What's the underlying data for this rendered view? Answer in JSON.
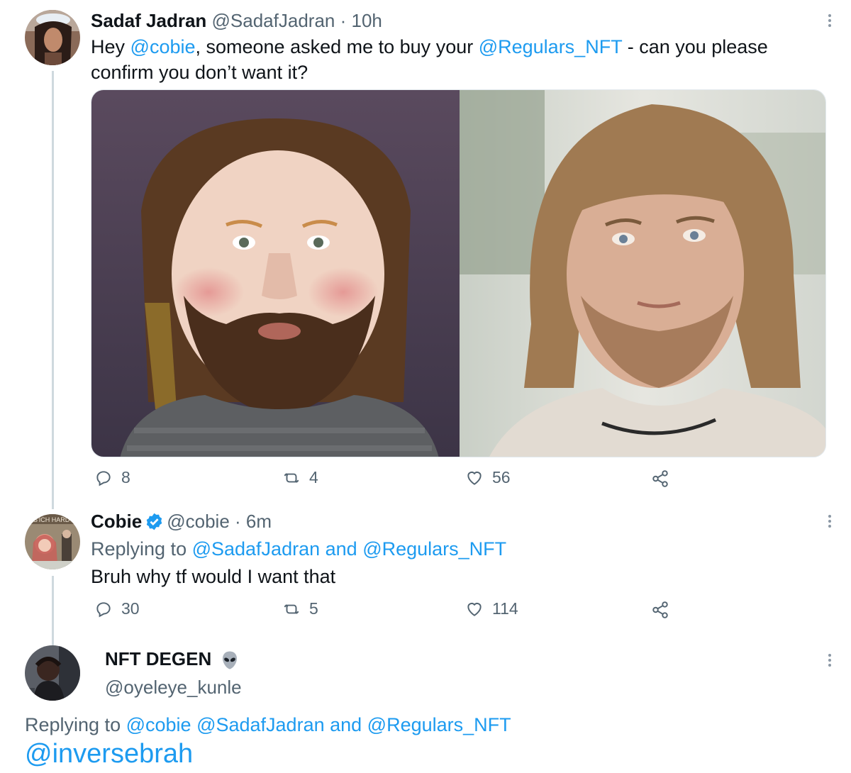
{
  "tweets": [
    {
      "author": "Sadaf Jadran",
      "handle": "@SadafJadran",
      "time": "· 10h",
      "text": {
        "p1": "Hey ",
        "m1": "@cobie",
        "p2": ", someone asked me to buy your ",
        "m2": "@Regulars_NFT",
        "p3": " - can you please",
        "line2": "confirm you don’t want it?"
      },
      "stats": {
        "replies": "8",
        "retweets": "4",
        "likes": "56"
      }
    },
    {
      "author": "Cobie",
      "handle": "@cobie",
      "time": "· 6m",
      "replying_label": "Replying to ",
      "replying_m1": "@SadafJadran",
      "replying_and": " and ",
      "replying_m2": "@Regulars_NFT",
      "text": "Bruh why tf would I want that",
      "stats": {
        "replies": "30",
        "retweets": "5",
        "likes": "114"
      }
    },
    {
      "author": "NFT DEGEN",
      "handle": "@oyeleye_kunle",
      "replying_label": "Replying to ",
      "replying_m1": "@cobie",
      "replying_m2": "@SadafJadran",
      "replying_and": " and ",
      "replying_m3": "@Regulars_NFT",
      "text_mention": "@inversebrah"
    }
  ],
  "icons": {
    "reply": "reply-icon",
    "retweet": "retweet-icon",
    "like": "heart-icon",
    "share": "share-icon",
    "more": "more-icon",
    "verified": "verified-badge-icon",
    "alien": "alien-emoji-icon"
  },
  "colors": {
    "link": "#1d9bf0",
    "muted": "#536471",
    "text": "#0f1419",
    "thread_line": "#cfd9de"
  }
}
